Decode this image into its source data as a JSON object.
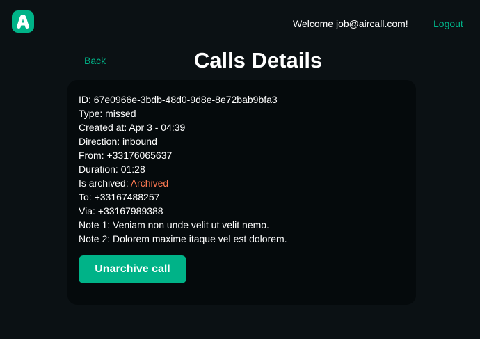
{
  "colors": {
    "background": "#0b1114",
    "card": "#050a0c",
    "accent": "#00b388",
    "archived": "#ff7a52",
    "text": "#ffffff"
  },
  "header": {
    "logo_icon": "aircall-logo-icon",
    "welcome_text": "Welcome job@aircall.com!",
    "logout_label": "Logout"
  },
  "nav": {
    "back_label": "Back"
  },
  "page": {
    "title": "Calls Details"
  },
  "call": {
    "id_label": "ID: ",
    "id": "67e0966e-3bdb-48d0-9d8e-8e72bab9bfa3",
    "type_label": "Type: ",
    "type": "missed",
    "created_label": "Created at: ",
    "created_at": "Apr 3 - 04:39",
    "direction_label": "Direction: ",
    "direction": "inbound",
    "from_label": "From: ",
    "from": "+33176065637",
    "duration_label": "Duration: ",
    "duration": "01:28",
    "archived_label": "Is archived: ",
    "archived": "Archived",
    "to_label": "To: ",
    "to": "+33167488257",
    "via_label": "Via: ",
    "via": "+33167989388",
    "note1_label": "Note 1: ",
    "note1": "Veniam non unde velit ut velit nemo.",
    "note2_label": "Note 2: ",
    "note2": "Dolorem maxime itaque vel est dolorem."
  },
  "actions": {
    "unarchive_label": "Unarchive call"
  }
}
